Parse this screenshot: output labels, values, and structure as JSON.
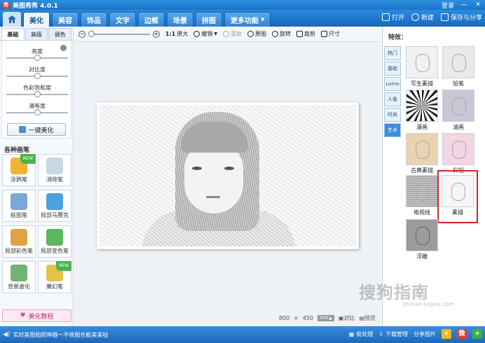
{
  "window": {
    "app_title": "美图秀秀 4.0.1",
    "login": "登录",
    "minimize": "—",
    "close": "✕"
  },
  "menu": {
    "tabs": [
      "美化",
      "美容",
      "饰品",
      "文字",
      "边框",
      "场景",
      "拼图",
      "更多功能"
    ],
    "active": "美化",
    "open": "打开",
    "new": "新建",
    "save_share": "保存与分享"
  },
  "left": {
    "subtabs": [
      "基础",
      "高级",
      "调色"
    ],
    "sliders": [
      {
        "label": "亮度",
        "value": 0.5
      },
      {
        "label": "对比度",
        "value": 0.5
      },
      {
        "label": "色彩饱和度",
        "value": 0.5
      },
      {
        "label": "清晰度",
        "value": 0.5
      }
    ],
    "one_click": "一键美化",
    "brush_title": "各种画笔",
    "brushes": [
      {
        "label": "涂鸦笔",
        "color": "#f2b434",
        "badge": "NEW"
      },
      {
        "label": "消除笔",
        "color": "#c9d6e3",
        "badge": ""
      },
      {
        "label": "抠图笔",
        "color": "#7aa8d8",
        "badge": ""
      },
      {
        "label": "局部马赛克",
        "color": "#4aa2e0",
        "badge": ""
      },
      {
        "label": "局部彩色笔",
        "color": "#e0a245",
        "badge": ""
      },
      {
        "label": "局部变色笔",
        "color": "#5bb85b",
        "badge": ""
      },
      {
        "label": "背景虚化",
        "color": "#6fb56f",
        "badge": ""
      },
      {
        "label": "魔幻笔",
        "color": "#e5c34a",
        "badge": "NEW"
      }
    ],
    "tutorial": "美化教程"
  },
  "toolbar": {
    "zoom_one": "1:1",
    "zoom_one_label": "原大",
    "undo": "撤销",
    "redo": "重做",
    "original": "原图",
    "rotate": "旋转",
    "crop": "裁剪",
    "size": "尺寸"
  },
  "status": {
    "width": "800",
    "times": "×",
    "height": "450",
    "exif": "EXIF▲",
    "compare": "对比",
    "preview": "预览"
  },
  "effects": {
    "title": "特效：",
    "categories": [
      "热门",
      "基础",
      "Lomo",
      "人像",
      "时尚",
      "艺术"
    ],
    "active_category": "艺术",
    "items": [
      {
        "label": "写生素描",
        "bg": "#f1f1f1"
      },
      {
        "label": "铅笔",
        "bg": "#eaeaea"
      },
      {
        "label": "漫画",
        "bg": "#dcdcdc"
      },
      {
        "label": "油画",
        "bg": "#c9c6d6"
      },
      {
        "label": "古典素描",
        "bg": "#e9d3b0"
      },
      {
        "label": "彩铅",
        "bg": "#f3d6e4"
      },
      {
        "label": "电视线",
        "bg": "#b4b4b4"
      },
      {
        "label": "素描",
        "bg": "#f6f6f6"
      },
      {
        "label": "浮雕",
        "bg": "#9c9c9c"
      }
    ]
  },
  "bottom": {
    "ticker": "实时美图拍照神器一不修图也能美美哒",
    "batch": "批处理",
    "download": "下载管理",
    "share": "分享图片"
  },
  "watermark": {
    "main": "搜狗指南",
    "sub": "zhinan.sogou.com"
  }
}
